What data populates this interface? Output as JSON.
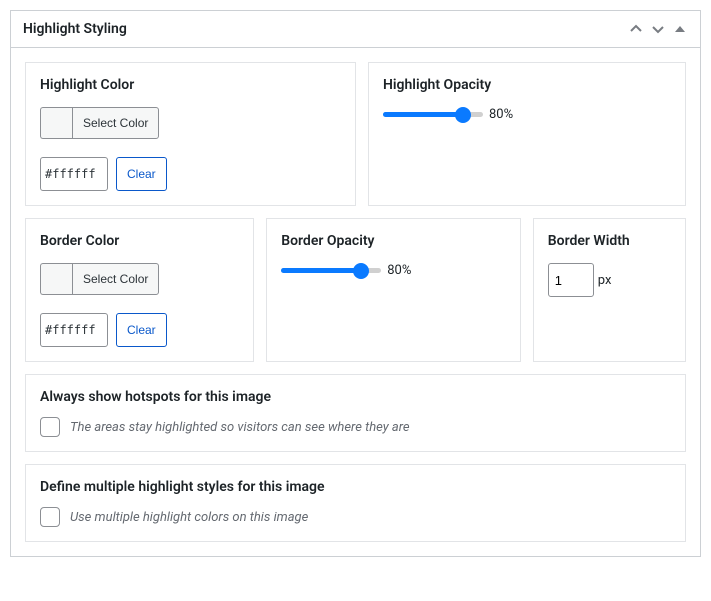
{
  "panel": {
    "title": "Highlight Styling"
  },
  "highlightColor": {
    "title": "Highlight Color",
    "selectLabel": "Select Color",
    "hex": "#ffffff",
    "clearLabel": "Clear"
  },
  "highlightOpacity": {
    "title": "Highlight Opacity",
    "valueLabel": "80%"
  },
  "borderColor": {
    "title": "Border Color",
    "selectLabel": "Select Color",
    "hex": "#ffffff",
    "clearLabel": "Clear"
  },
  "borderOpacity": {
    "title": "Border Opacity",
    "valueLabel": "80%"
  },
  "borderWidth": {
    "title": "Border Width",
    "value": "1",
    "unit": "px"
  },
  "alwaysShow": {
    "title": "Always show hotspots for this image",
    "desc": "The areas stay highlighted so visitors can see where they are"
  },
  "multipleStyles": {
    "title": "Define multiple highlight styles for this image",
    "desc": "Use multiple highlight colors on this image"
  }
}
